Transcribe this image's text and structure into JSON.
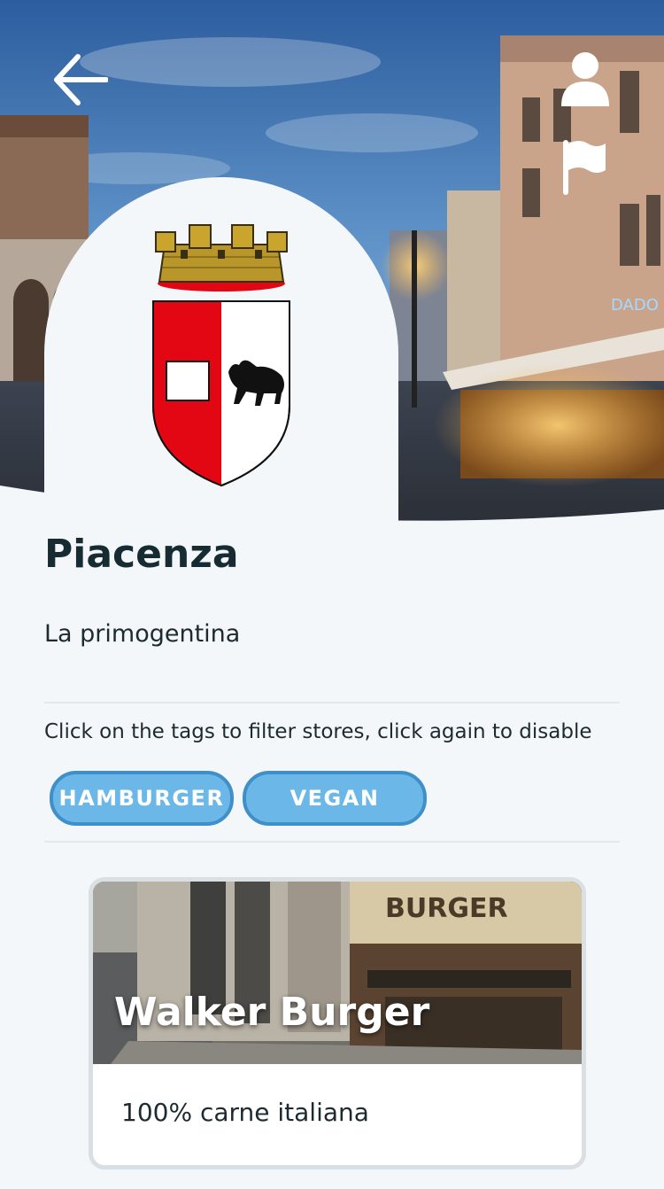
{
  "header": {
    "back_icon": "arrow-left-icon",
    "user_icon": "user-icon",
    "flag_icon": "flag-icon"
  },
  "city": {
    "name": "Piacenza",
    "tagline": "La primogentina",
    "crest_icon": "coat-of-arms-icon"
  },
  "filters": {
    "hint": "Click on the tags to filter stores, click again to disable",
    "tags": [
      "HAMBURGER",
      "VEGAN"
    ]
  },
  "stores": [
    {
      "name": "Walker Burger",
      "description": "100% carne italiana",
      "sign_text": "BURGER"
    }
  ],
  "colors": {
    "tag_fill": "#6bb8e8",
    "tag_border": "#3f8fc8",
    "background": "#f4f7fa",
    "crest_red": "#e30613"
  }
}
